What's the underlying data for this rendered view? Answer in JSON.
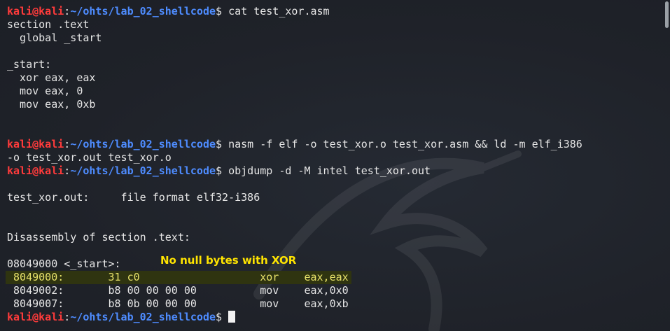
{
  "terminal": {
    "prompt": {
      "user_host": "kali@kali",
      "sep": ":",
      "path": "~/ohts/lab_02_shellcode",
      "symbol": "$ "
    },
    "lines": [
      {
        "type": "prompt",
        "cmd": "cat test_xor.asm"
      },
      {
        "type": "text",
        "text": "section .text"
      },
      {
        "type": "text",
        "text": "  global _start"
      },
      {
        "type": "text",
        "text": ""
      },
      {
        "type": "text",
        "text": "_start:"
      },
      {
        "type": "text",
        "text": "  xor eax, eax"
      },
      {
        "type": "text",
        "text": "  mov eax, 0"
      },
      {
        "type": "text",
        "text": "  mov eax, 0xb"
      },
      {
        "type": "text",
        "text": ""
      },
      {
        "type": "text",
        "text": ""
      },
      {
        "type": "prompt",
        "cmd": "nasm -f elf -o test_xor.o test_xor.asm && ld -m elf_i386"
      },
      {
        "type": "text",
        "text": "-o test_xor.out test_xor.o"
      },
      {
        "type": "prompt",
        "cmd": "objdump -d -M intel test_xor.out"
      },
      {
        "type": "text",
        "text": ""
      },
      {
        "type": "text",
        "text": "test_xor.out:     file format elf32-i386"
      },
      {
        "type": "text",
        "text": ""
      },
      {
        "type": "text",
        "text": ""
      },
      {
        "type": "text",
        "text": "Disassembly of section .text:"
      },
      {
        "type": "text",
        "text": ""
      },
      {
        "type": "text",
        "text": "08049000 <_start>:"
      },
      {
        "type": "highlight",
        "text": " 8049000:       31 c0                   xor    eax,eax"
      },
      {
        "type": "text",
        "text": " 8049002:       b8 00 00 00 00          mov    eax,0x0"
      },
      {
        "type": "text",
        "text": " 8049007:       b8 0b 00 00 00          mov    eax,0xb"
      },
      {
        "type": "prompt_cursor",
        "cmd": ""
      }
    ]
  },
  "annotation": {
    "text": "No null bytes with XOR",
    "color": "#ffe400"
  },
  "colors": {
    "background": "#1f2229",
    "user_host": "#ff3b3b",
    "path": "#4e8cff",
    "text": "#e6e6e6",
    "highlight_bg": "#2f3410",
    "highlight_fg": "#e8e26a"
  },
  "icons": {
    "watermark": "kali-dragon-icon"
  }
}
